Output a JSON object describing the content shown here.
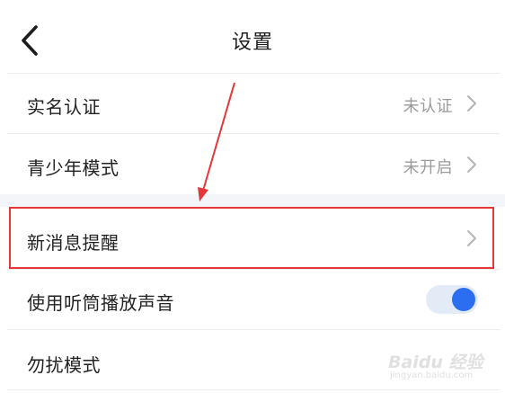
{
  "header": {
    "title": "设置",
    "back_icon": "chevron-left-icon"
  },
  "rows": [
    {
      "label": "实名认证",
      "value": "未认证"
    },
    {
      "label": "青少年模式",
      "value": "未开启"
    },
    {
      "label": "新消息提醒",
      "value": ""
    },
    {
      "label": "使用听筒播放声音",
      "toggle_on": true
    },
    {
      "label": "勿扰模式"
    }
  ],
  "colors": {
    "accent": "#2b6ff0",
    "highlight": "#e5363a",
    "value_text": "#9b9b9b"
  },
  "watermark": {
    "brand": "Baidu 经验",
    "site": "jingyan.baidu.com"
  }
}
